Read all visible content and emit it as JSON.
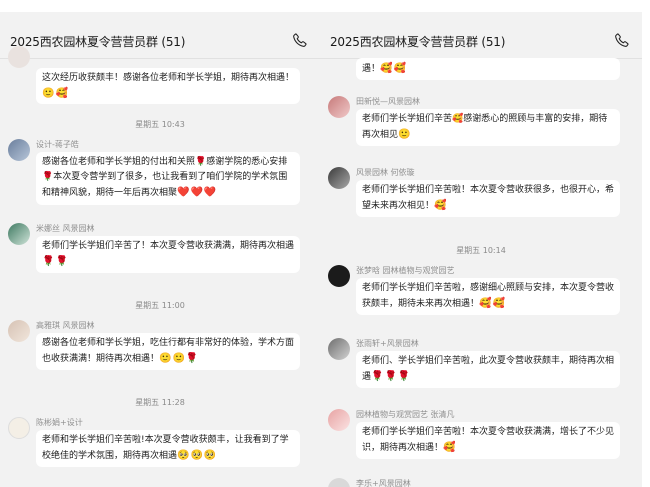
{
  "left": {
    "title": "2025西农园林夏令营营员群 (51)",
    "top_bubble": {
      "text": "这次经历收获颇丰！感谢各位老师和学长学姐，期待再次相遇！",
      "emoji": "🙂🥰"
    },
    "time1": "星期五 10:43",
    "msg1": {
      "sender": "设计-蒋子皓",
      "text": "感谢各位老师和学长学姐的付出和关照🌹感谢学院的悉心安排🌹本次夏令营学到了很多，也让我看到了咱们学院的学术氛围和精神风貌，期待一年后再次相聚",
      "emoji": "❤️❤️❤️"
    },
    "msg2": {
      "sender": "米娜丝 风景园林",
      "text": "老师们学长学姐们辛苦了！本次夏令营收获满满，期待再次相遇",
      "emoji": "🌹🌹"
    },
    "time2": "星期五 11:00",
    "msg3": {
      "sender": "高雅琪 风景园林",
      "text": "感谢各位老师和学长学姐，吃住行都有非常好的体验，学术方面也收获满满！期待再次相遇！",
      "emoji": "🙂🙂🌹"
    },
    "time3": "星期五 11:28",
    "msg4": {
      "sender": "陈彬娟+设计",
      "text": "老师和学长学姐们辛苦啦!本次夏令营收获颇丰，让我看到了学校绝佳的学术氛围，期待再次相遇",
      "emoji": "🥺🥺🥺"
    }
  },
  "right": {
    "title": "2025西农园林夏令营营员群 (51)",
    "top_bubble": {
      "text": "遇！",
      "emoji": "🥰🥰"
    },
    "msg1": {
      "sender": "田新悦—风景园林",
      "text": "老师们学长学姐们辛苦🥰感谢悉心的照顾与丰富的安排，期待再次相见",
      "emoji": "🙂"
    },
    "msg2": {
      "sender": "风景园林 何依璇",
      "text": "老师们学长学姐们辛苦啦！本次夏令营收获很多，也很开心，希望未来再次相见！",
      "emoji": "🥰"
    },
    "time1": "星期五 10:14",
    "msg3": {
      "sender": "张梦晗 园林植物与观赏园艺",
      "text": "老师们学长学姐们辛苦啦，感谢细心照顾与安排，本次夏令营收获颇丰，期待未来再次相遇！",
      "emoji": "🥰🥰"
    },
    "msg4": {
      "sender": "张雨轩+风景园林",
      "text": "老师们、学长学姐们辛苦啦，此次夏令营收获颇丰，期待再次相遇",
      "emoji": "🌹🌹🌹"
    },
    "msg5": {
      "sender": "园林植物与观赏园艺 张清凡",
      "text": "老师们学长学姐们辛苦啦！本次夏令营收获满满，增长了不少见识，期待再次相遇！",
      "emoji": "🥰"
    },
    "msg6": {
      "sender": "李乐+风景园林"
    }
  },
  "icons": {
    "phone": "phone-icon"
  }
}
